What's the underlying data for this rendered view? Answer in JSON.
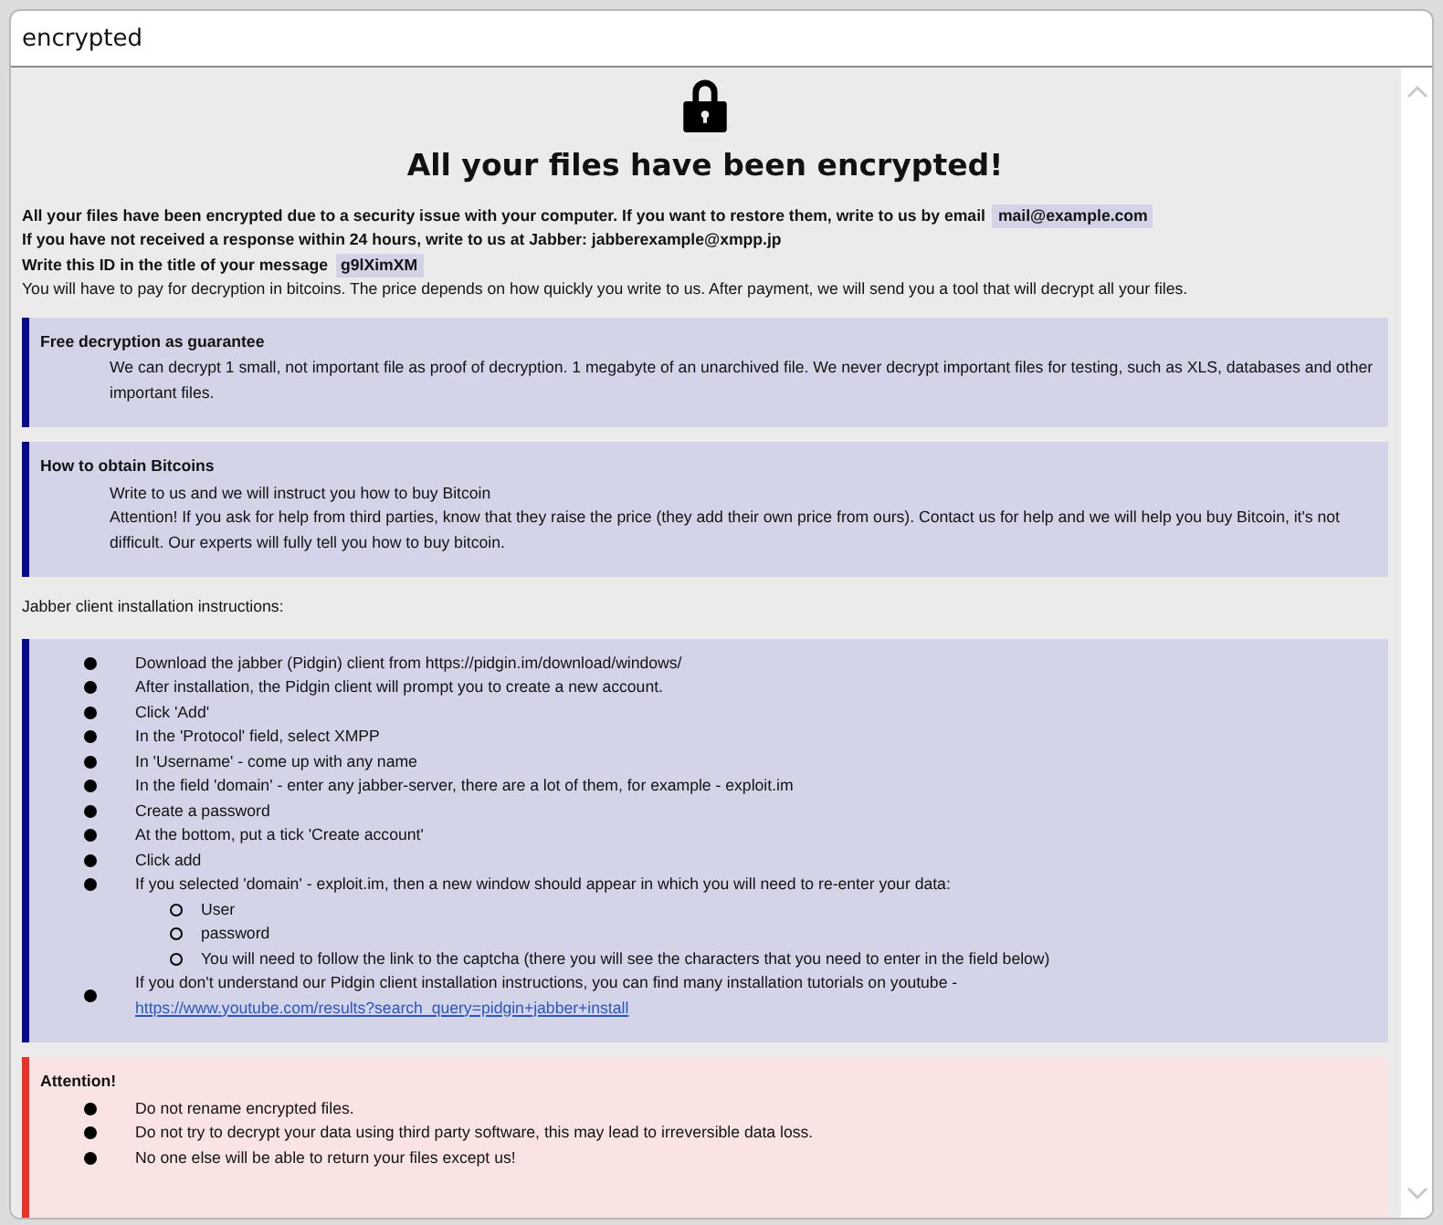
{
  "window": {
    "title": "encrypted"
  },
  "heading": "All your files have been encrypted!",
  "intro": [
    {
      "text": "All your files have been encrypted due to a security issue with your computer. If you want to restore them, write to us by email",
      "highlight": "mail@example.com",
      "bold": true
    },
    {
      "text": "If you have not received a response within 24 hours, write to us at Jabber: jabberexample@xmpp.jp",
      "bold": true
    },
    {
      "text": "Write this ID in the title of your message",
      "highlight": "g9lXimXM",
      "bold": true
    },
    {
      "text": "You will have to pay for decryption in bitcoins. The price depends on how quickly you write to us. After payment, we will send you a tool that will decrypt all your files.",
      "bold": false
    }
  ],
  "blocks": [
    {
      "kind": "info",
      "title": "Free decryption as guarantee",
      "paragraphs": [
        "We can decrypt 1 small, not important file as proof of decryption. 1 megabyte of an unarchived file. We never decrypt important files for testing, such as XLS, databases and other important files."
      ]
    },
    {
      "kind": "info",
      "title": "How to obtain Bitcoins",
      "paragraphs": [
        "Write to us and we will instruct you how to buy Bitcoin",
        "Attention! If you ask for help from third parties, know that they raise the price (they add their own price from ours). Contact us for help and we will help you buy Bitcoin, it's not difficult. Our experts will fully tell you how to buy bitcoin."
      ]
    },
    {
      "kind": "caption",
      "text": "Jabber client installation instructions:"
    },
    {
      "kind": "info",
      "items": [
        {
          "text": "Download the jabber (Pidgin) client from https://pidgin.im/download/windows/"
        },
        {
          "text": "After installation, the Pidgin client will prompt you to create a new account."
        },
        {
          "text": "Click 'Add'"
        },
        {
          "text": "In the 'Protocol' field, select XMPP"
        },
        {
          "text": "In 'Username' - come up with any name"
        },
        {
          "text": "In the field 'domain' - enter any jabber-server, there are a lot of them, for example - exploit.im"
        },
        {
          "text": "Create a password"
        },
        {
          "text": "At the bottom, put a tick 'Create account'"
        },
        {
          "text": "Click add"
        },
        {
          "text": "If you selected 'domain' - exploit.im, then a new window should appear in which you will need to re-enter your data:",
          "children": [
            {
              "text": "User"
            },
            {
              "text": "password"
            },
            {
              "text": "You will need to follow the link to the captcha (there you will see the characters that you need to enter in the field below)"
            }
          ]
        },
        {
          "text": "If you don't understand our Pidgin client installation instructions, you can find many installation tutorials on youtube -",
          "link": "https://www.youtube.com/results?search_query=pidgin+jabber+install"
        }
      ]
    },
    {
      "kind": "warning",
      "title": "Attention!",
      "items": [
        {
          "text": "Do not rename encrypted files."
        },
        {
          "text": "Do not try to decrypt your data using third party software, this may lead to irreversible data loss."
        },
        {
          "text": "No one else will be able to return your files except us!"
        }
      ]
    }
  ]
}
